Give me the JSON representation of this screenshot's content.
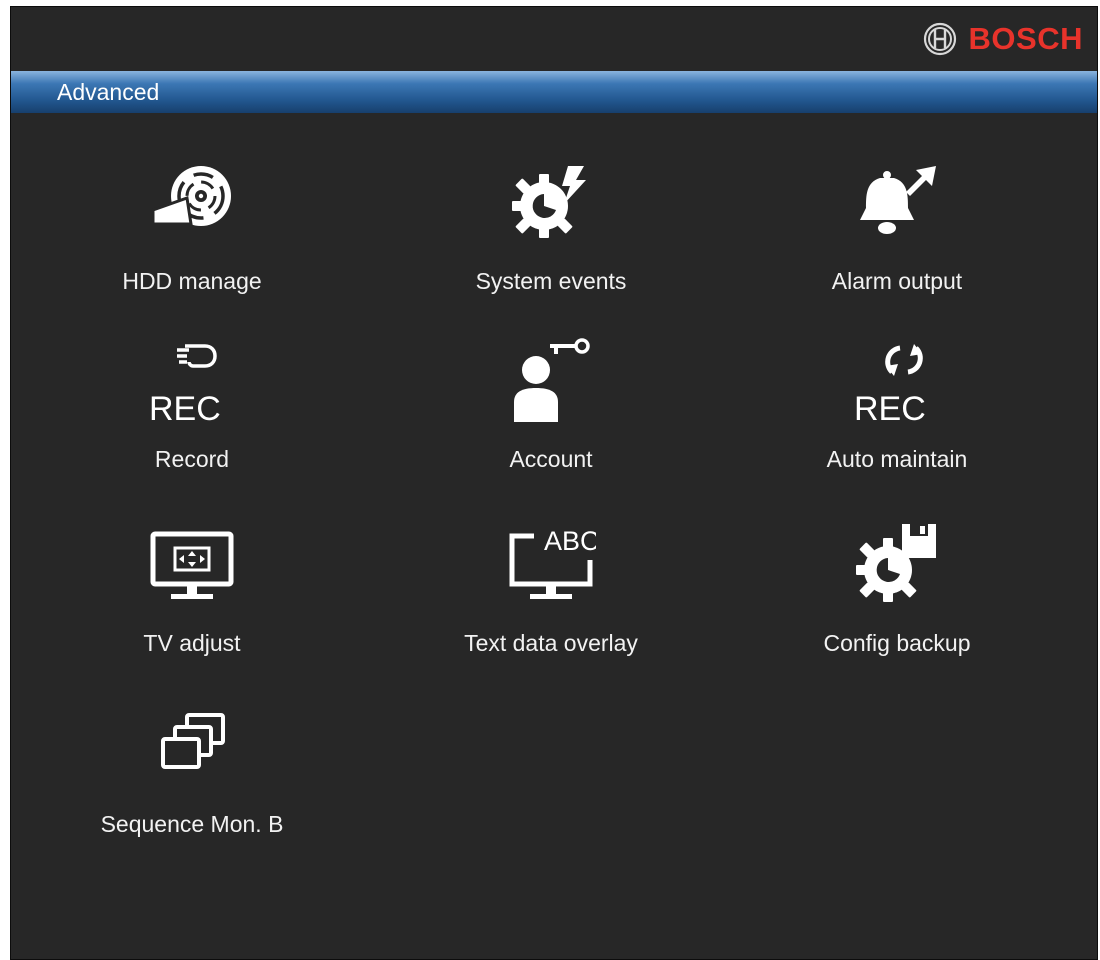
{
  "brand": {
    "name": "BOSCH",
    "logo_icon": "bosch-armature-icon",
    "color": "#e8332b"
  },
  "header": {
    "title": "Advanced"
  },
  "colors": {
    "background": "#272727",
    "titlebar": "#2c6aa8",
    "text": "#f2f2f2"
  },
  "menu": {
    "items": [
      {
        "label": "HDD manage",
        "icon": "hdd-disk-icon"
      },
      {
        "label": "System events",
        "icon": "gear-lightning-icon"
      },
      {
        "label": "Alarm output",
        "icon": "bell-arrow-icon"
      },
      {
        "label": "Record",
        "icon": "hand-pointer-rec-icon",
        "icon_text": "REC"
      },
      {
        "label": "Account",
        "icon": "user-key-icon"
      },
      {
        "label": "Auto maintain",
        "icon": "refresh-rec-icon",
        "icon_text": "REC"
      },
      {
        "label": "TV adjust",
        "icon": "monitor-arrows-icon"
      },
      {
        "label": "Text data overlay",
        "icon": "monitor-abc-icon",
        "icon_text": "ABC"
      },
      {
        "label": "Config backup",
        "icon": "gear-floppy-icon"
      },
      {
        "label": "Sequence Mon. B",
        "icon": "stacked-windows-icon"
      }
    ]
  }
}
